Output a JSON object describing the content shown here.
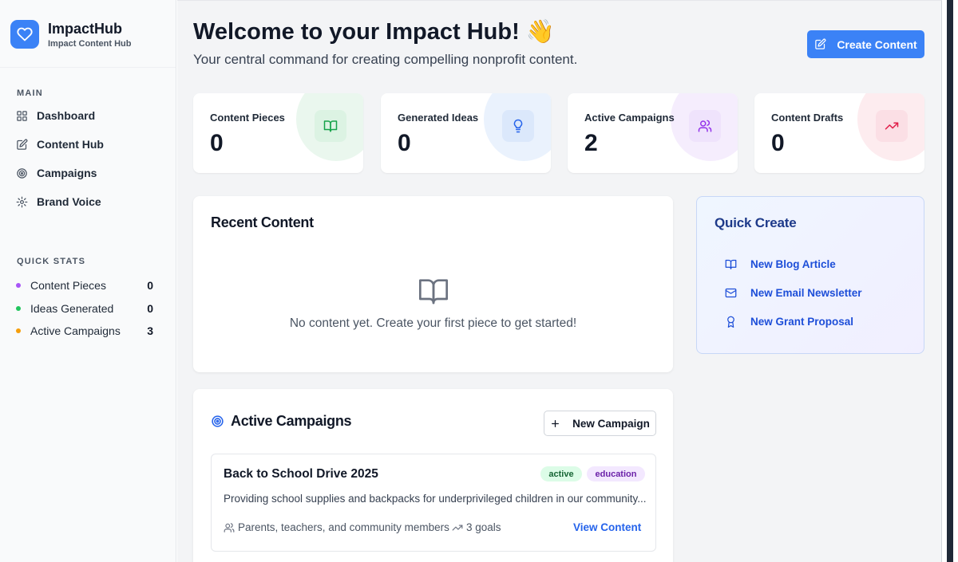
{
  "brand": {
    "name": "ImpactHub",
    "subtitle": "Impact Content Hub",
    "icon": "heart-icon"
  },
  "sidebar": {
    "main_label": "MAIN",
    "nav": [
      {
        "label": "Dashboard",
        "icon": "dashboard-icon"
      },
      {
        "label": "Content Hub",
        "icon": "edit-icon"
      },
      {
        "label": "Campaigns",
        "icon": "target-icon"
      },
      {
        "label": "Brand Voice",
        "icon": "gear-icon"
      }
    ],
    "stats_label": "QUICK STATS",
    "stats": [
      {
        "label": "Content Pieces",
        "value": "0",
        "color": "#a855f7"
      },
      {
        "label": "Ideas Generated",
        "value": "0",
        "color": "#22c55e"
      },
      {
        "label": "Active Campaigns",
        "value": "3",
        "color": "#f59e0b"
      }
    ]
  },
  "header": {
    "title": "Welcome to your Impact Hub! 👋",
    "subtitle": "Your central command for creating compelling nonprofit content.",
    "create_button": "Create Content"
  },
  "stat_cards": [
    {
      "label": "Content Pieces",
      "value": "0",
      "icon": "book-icon",
      "accent": "#16a34a"
    },
    {
      "label": "Generated Ideas",
      "value": "0",
      "icon": "lightbulb-icon",
      "accent": "#2563eb"
    },
    {
      "label": "Active Campaigns",
      "value": "2",
      "icon": "users-icon",
      "accent": "#9333ea"
    },
    {
      "label": "Content Drafts",
      "value": "0",
      "icon": "trending-up-icon",
      "accent": "#e11d48"
    }
  ],
  "recent": {
    "title": "Recent Content",
    "empty_text": "No content yet. Create your first piece to get started!"
  },
  "quick_create": {
    "title": "Quick Create",
    "items": [
      {
        "label": "New Blog Article",
        "icon": "book-icon"
      },
      {
        "label": "New Email Newsletter",
        "icon": "mail-icon"
      },
      {
        "label": "New Grant Proposal",
        "icon": "award-icon"
      }
    ]
  },
  "campaigns": {
    "title": "Active Campaigns",
    "new_button": "New Campaign",
    "items": [
      {
        "title": "Back to School Drive 2025",
        "status": "active",
        "category": "education",
        "description": "Providing school supplies and backpacks for underprivileged children in our community...",
        "audience": "Parents, teachers, and community members",
        "goals": "3 goals",
        "link": "View Content"
      }
    ]
  }
}
